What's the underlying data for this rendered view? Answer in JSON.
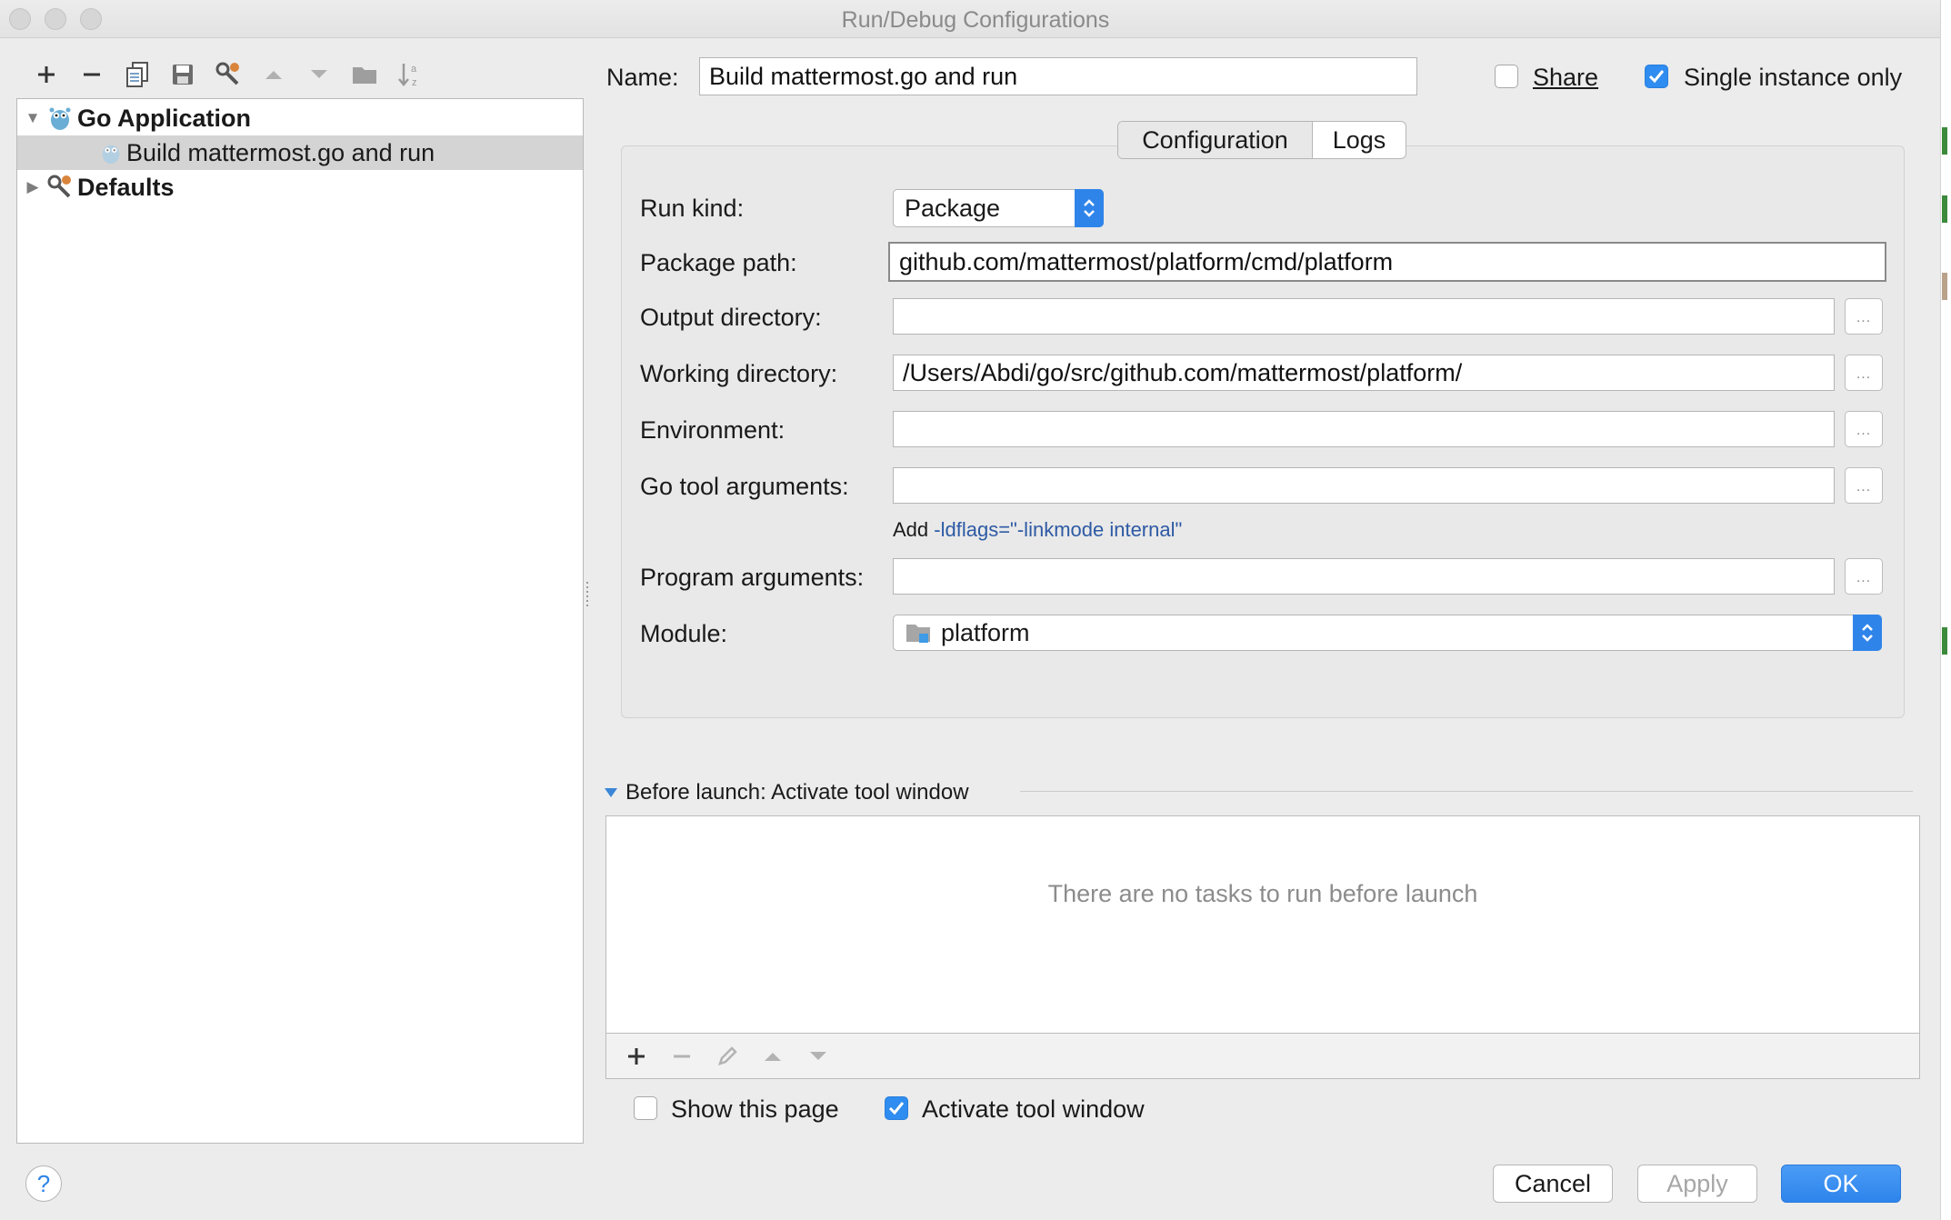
{
  "window": {
    "title": "Run/Debug Configurations"
  },
  "toolbar": {
    "items": [
      {
        "icon": "plus-icon"
      },
      {
        "icon": "minus-icon"
      },
      {
        "icon": "copy-icon"
      },
      {
        "icon": "save-icon"
      },
      {
        "icon": "wrench-icon"
      },
      {
        "icon": "arrow-up-icon"
      },
      {
        "icon": "arrow-down-icon"
      },
      {
        "icon": "folder-icon"
      },
      {
        "icon": "sort-az-icon"
      }
    ]
  },
  "tree": {
    "go_application": "Go Application",
    "build_config": "Build mattermost.go and run",
    "defaults": "Defaults"
  },
  "header": {
    "name_label": "Name:",
    "name_value": "Build mattermost.go and run",
    "share_label": "Share",
    "share_checked": false,
    "single_instance_label": "Single instance only",
    "single_instance_checked": true
  },
  "tabs": {
    "configuration": "Configuration",
    "logs": "Logs",
    "active": "Configuration"
  },
  "form": {
    "run_kind_label": "Run kind:",
    "run_kind_value": "Package",
    "package_path_label": "Package path:",
    "package_path_value": "github.com/mattermost/platform/cmd/platform",
    "output_dir_label": "Output directory:",
    "output_dir_value": "",
    "working_dir_label": "Working directory:",
    "working_dir_value": "/Users/Abdi/go/src/github.com/mattermost/platform/",
    "environment_label": "Environment:",
    "environment_value": "",
    "go_tool_args_label": "Go tool arguments:",
    "go_tool_args_value": "",
    "hint_prefix": "Add",
    "hint_link": "-ldflags=\"-linkmode internal\"",
    "program_args_label": "Program arguments:",
    "program_args_value": "",
    "module_label": "Module:",
    "module_value": "platform",
    "browse_label": "..."
  },
  "before_launch": {
    "header": "Before launch: Activate tool window",
    "empty_text": "There are no tasks to run before launch",
    "show_page_label": "Show this page",
    "show_page_checked": false,
    "activate_label": "Activate tool window",
    "activate_checked": true
  },
  "buttons": {
    "help": "?",
    "cancel": "Cancel",
    "apply": "Apply",
    "ok": "OK"
  },
  "colors": {
    "accent": "#2f84ea",
    "link": "#2d5aa4",
    "selection": "#d4d4d4"
  }
}
